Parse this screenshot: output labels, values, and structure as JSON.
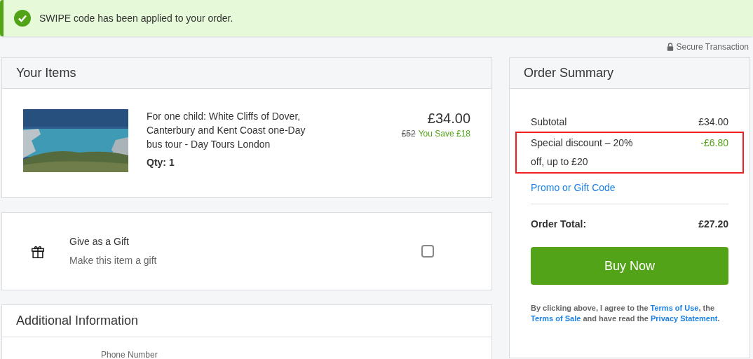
{
  "banner": {
    "message": "SWIPE code has been applied to your order."
  },
  "secure_label": "Secure Transaction",
  "items_card": {
    "title": "Your Items",
    "items": [
      {
        "kind": "picture",
        "title": "For one child: White Cliffs of Dover, Canterbury and Kent Coast one-Day bus tour - Day Tours London",
        "qty": "Qty: 1",
        "price": "£34.00",
        "original_price": "£52",
        "savings": "You Save £18"
      }
    ]
  },
  "gift": {
    "title": "Give as a Gift",
    "subtitle": "Make this item a gift",
    "checked": false
  },
  "additional": {
    "title": "Additional Information",
    "fields": [
      {
        "label": "Phone Number"
      }
    ]
  },
  "summary": {
    "title": "Order Summary",
    "lines": [
      {
        "kind": "normal",
        "label": "Subtotal",
        "value": "£34.00",
        "highlighted": false
      },
      {
        "kind": "discount",
        "label": "Special discount – 20% off, up to £20",
        "value": "-£6.80",
        "highlighted": true
      }
    ],
    "promo_link": "Promo or Gift Code",
    "total_label": "Order Total:",
    "total_value": "£27.20",
    "buy_button": "Buy Now",
    "legal": [
      {
        "kind": "text",
        "text": "By clicking above, I agree to the "
      },
      {
        "kind": "link",
        "text": "Terms of Use"
      },
      {
        "kind": "text",
        "text": ", the "
      },
      {
        "kind": "link",
        "text": "Terms of Sale"
      },
      {
        "kind": "text",
        "text": " and have read the "
      },
      {
        "kind": "link",
        "text": "Privacy Statement"
      },
      {
        "kind": "text",
        "text": "."
      }
    ]
  }
}
